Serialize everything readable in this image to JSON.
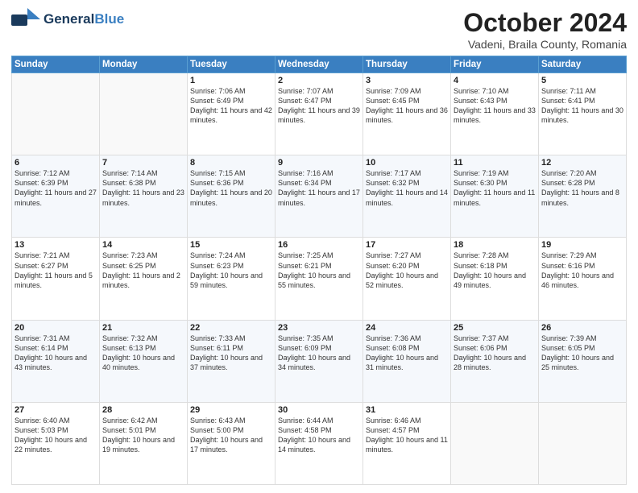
{
  "header": {
    "logo_line1": "General",
    "logo_line2": "Blue",
    "title": "October 2024",
    "subtitle": "Vadeni, Braila County, Romania"
  },
  "days_of_week": [
    "Sunday",
    "Monday",
    "Tuesday",
    "Wednesday",
    "Thursday",
    "Friday",
    "Saturday"
  ],
  "weeks": [
    [
      {
        "day": "",
        "sunrise": "",
        "sunset": "",
        "daylight": ""
      },
      {
        "day": "",
        "sunrise": "",
        "sunset": "",
        "daylight": ""
      },
      {
        "day": "1",
        "sunrise": "Sunrise: 7:06 AM",
        "sunset": "Sunset: 6:49 PM",
        "daylight": "Daylight: 11 hours and 42 minutes."
      },
      {
        "day": "2",
        "sunrise": "Sunrise: 7:07 AM",
        "sunset": "Sunset: 6:47 PM",
        "daylight": "Daylight: 11 hours and 39 minutes."
      },
      {
        "day": "3",
        "sunrise": "Sunrise: 7:09 AM",
        "sunset": "Sunset: 6:45 PM",
        "daylight": "Daylight: 11 hours and 36 minutes."
      },
      {
        "day": "4",
        "sunrise": "Sunrise: 7:10 AM",
        "sunset": "Sunset: 6:43 PM",
        "daylight": "Daylight: 11 hours and 33 minutes."
      },
      {
        "day": "5",
        "sunrise": "Sunrise: 7:11 AM",
        "sunset": "Sunset: 6:41 PM",
        "daylight": "Daylight: 11 hours and 30 minutes."
      }
    ],
    [
      {
        "day": "6",
        "sunrise": "Sunrise: 7:12 AM",
        "sunset": "Sunset: 6:39 PM",
        "daylight": "Daylight: 11 hours and 27 minutes."
      },
      {
        "day": "7",
        "sunrise": "Sunrise: 7:14 AM",
        "sunset": "Sunset: 6:38 PM",
        "daylight": "Daylight: 11 hours and 23 minutes."
      },
      {
        "day": "8",
        "sunrise": "Sunrise: 7:15 AM",
        "sunset": "Sunset: 6:36 PM",
        "daylight": "Daylight: 11 hours and 20 minutes."
      },
      {
        "day": "9",
        "sunrise": "Sunrise: 7:16 AM",
        "sunset": "Sunset: 6:34 PM",
        "daylight": "Daylight: 11 hours and 17 minutes."
      },
      {
        "day": "10",
        "sunrise": "Sunrise: 7:17 AM",
        "sunset": "Sunset: 6:32 PM",
        "daylight": "Daylight: 11 hours and 14 minutes."
      },
      {
        "day": "11",
        "sunrise": "Sunrise: 7:19 AM",
        "sunset": "Sunset: 6:30 PM",
        "daylight": "Daylight: 11 hours and 11 minutes."
      },
      {
        "day": "12",
        "sunrise": "Sunrise: 7:20 AM",
        "sunset": "Sunset: 6:28 PM",
        "daylight": "Daylight: 11 hours and 8 minutes."
      }
    ],
    [
      {
        "day": "13",
        "sunrise": "Sunrise: 7:21 AM",
        "sunset": "Sunset: 6:27 PM",
        "daylight": "Daylight: 11 hours and 5 minutes."
      },
      {
        "day": "14",
        "sunrise": "Sunrise: 7:23 AM",
        "sunset": "Sunset: 6:25 PM",
        "daylight": "Daylight: 11 hours and 2 minutes."
      },
      {
        "day": "15",
        "sunrise": "Sunrise: 7:24 AM",
        "sunset": "Sunset: 6:23 PM",
        "daylight": "Daylight: 10 hours and 59 minutes."
      },
      {
        "day": "16",
        "sunrise": "Sunrise: 7:25 AM",
        "sunset": "Sunset: 6:21 PM",
        "daylight": "Daylight: 10 hours and 55 minutes."
      },
      {
        "day": "17",
        "sunrise": "Sunrise: 7:27 AM",
        "sunset": "Sunset: 6:20 PM",
        "daylight": "Daylight: 10 hours and 52 minutes."
      },
      {
        "day": "18",
        "sunrise": "Sunrise: 7:28 AM",
        "sunset": "Sunset: 6:18 PM",
        "daylight": "Daylight: 10 hours and 49 minutes."
      },
      {
        "day": "19",
        "sunrise": "Sunrise: 7:29 AM",
        "sunset": "Sunset: 6:16 PM",
        "daylight": "Daylight: 10 hours and 46 minutes."
      }
    ],
    [
      {
        "day": "20",
        "sunrise": "Sunrise: 7:31 AM",
        "sunset": "Sunset: 6:14 PM",
        "daylight": "Daylight: 10 hours and 43 minutes."
      },
      {
        "day": "21",
        "sunrise": "Sunrise: 7:32 AM",
        "sunset": "Sunset: 6:13 PM",
        "daylight": "Daylight: 10 hours and 40 minutes."
      },
      {
        "day": "22",
        "sunrise": "Sunrise: 7:33 AM",
        "sunset": "Sunset: 6:11 PM",
        "daylight": "Daylight: 10 hours and 37 minutes."
      },
      {
        "day": "23",
        "sunrise": "Sunrise: 7:35 AM",
        "sunset": "Sunset: 6:09 PM",
        "daylight": "Daylight: 10 hours and 34 minutes."
      },
      {
        "day": "24",
        "sunrise": "Sunrise: 7:36 AM",
        "sunset": "Sunset: 6:08 PM",
        "daylight": "Daylight: 10 hours and 31 minutes."
      },
      {
        "day": "25",
        "sunrise": "Sunrise: 7:37 AM",
        "sunset": "Sunset: 6:06 PM",
        "daylight": "Daylight: 10 hours and 28 minutes."
      },
      {
        "day": "26",
        "sunrise": "Sunrise: 7:39 AM",
        "sunset": "Sunset: 6:05 PM",
        "daylight": "Daylight: 10 hours and 25 minutes."
      }
    ],
    [
      {
        "day": "27",
        "sunrise": "Sunrise: 6:40 AM",
        "sunset": "Sunset: 5:03 PM",
        "daylight": "Daylight: 10 hours and 22 minutes."
      },
      {
        "day": "28",
        "sunrise": "Sunrise: 6:42 AM",
        "sunset": "Sunset: 5:01 PM",
        "daylight": "Daylight: 10 hours and 19 minutes."
      },
      {
        "day": "29",
        "sunrise": "Sunrise: 6:43 AM",
        "sunset": "Sunset: 5:00 PM",
        "daylight": "Daylight: 10 hours and 17 minutes."
      },
      {
        "day": "30",
        "sunrise": "Sunrise: 6:44 AM",
        "sunset": "Sunset: 4:58 PM",
        "daylight": "Daylight: 10 hours and 14 minutes."
      },
      {
        "day": "31",
        "sunrise": "Sunrise: 6:46 AM",
        "sunset": "Sunset: 4:57 PM",
        "daylight": "Daylight: 10 hours and 11 minutes."
      },
      {
        "day": "",
        "sunrise": "",
        "sunset": "",
        "daylight": ""
      },
      {
        "day": "",
        "sunrise": "",
        "sunset": "",
        "daylight": ""
      }
    ]
  ]
}
